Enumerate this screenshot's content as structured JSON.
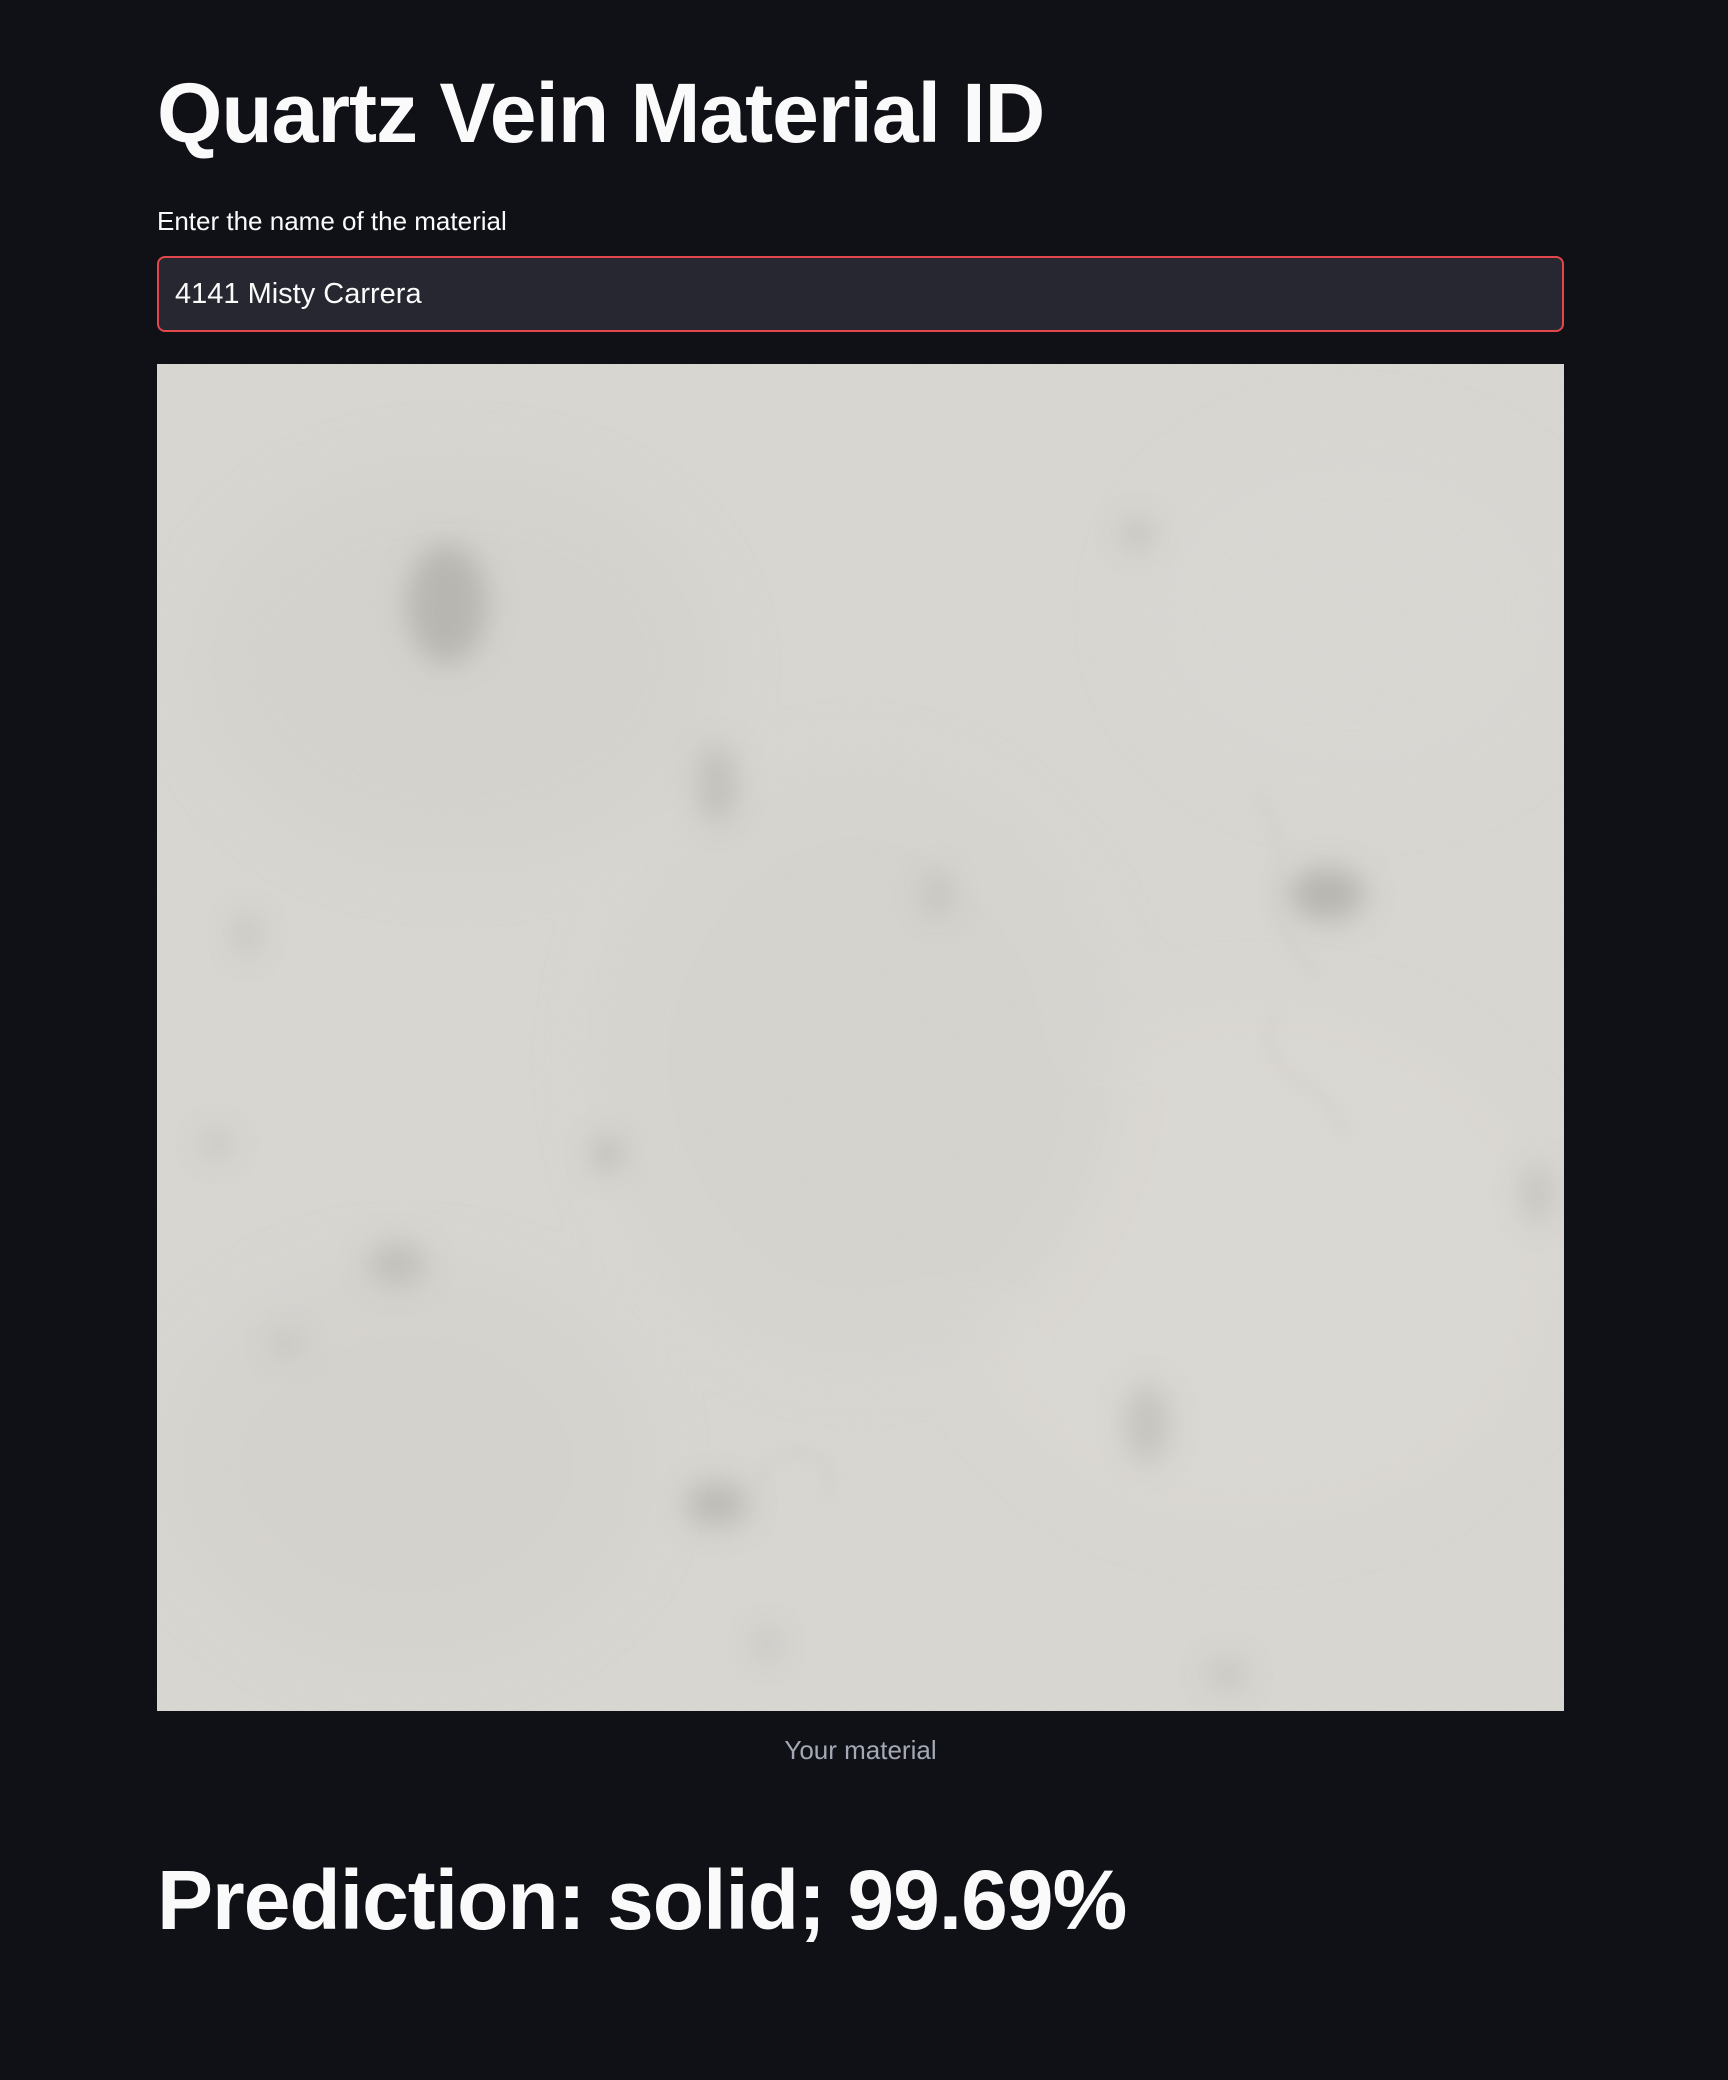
{
  "app": {
    "title": "Quartz Vein Material ID"
  },
  "form": {
    "label": "Enter the name of the material",
    "input_value": "4141 Misty Carrera"
  },
  "image": {
    "caption": "Your material",
    "alt": "material-texture"
  },
  "result": {
    "prediction_text": "Prediction: solid; 99.69%",
    "label": "solid",
    "confidence_percent": 99.69
  },
  "colors": {
    "background": "#0f1117",
    "input_background": "#262730",
    "input_focus_border": "#e2484b",
    "text": "#fafafa",
    "caption": "#a3a8b4",
    "stone_base": "#d9d7d2"
  }
}
